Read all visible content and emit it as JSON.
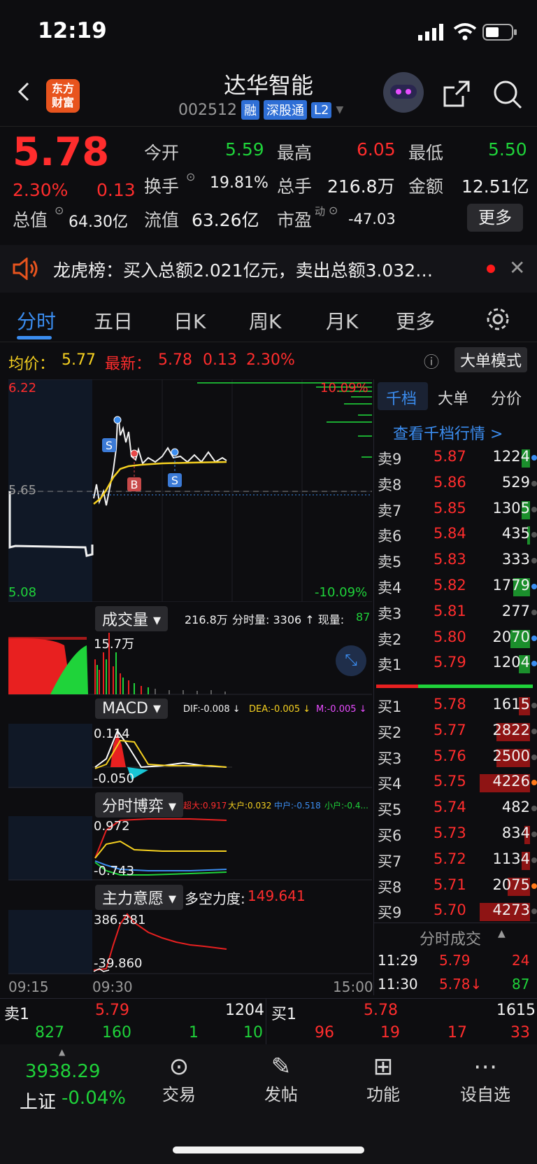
{
  "status": {
    "time": "12:19"
  },
  "header": {
    "logo_text": "东方\n财富",
    "stock_name": "达华智能",
    "code": "002512",
    "tags": [
      "融",
      "深股通",
      "L2"
    ]
  },
  "quote": {
    "price": "5.78",
    "pct": "2.30%",
    "change": "0.13",
    "open_label": "今开",
    "open": "5.59",
    "high_label": "最高",
    "high": "6.05",
    "low_label": "最低",
    "low": "5.50",
    "turnover_label": "换手",
    "turnover": "19.81%",
    "vol_label": "总手",
    "vol": "216.8万",
    "amount_label": "金额",
    "amount": "12.51亿",
    "mktcap_label": "总值",
    "mktcap": "64.30亿",
    "float_label": "流值",
    "float": "63.26亿",
    "pe_label": "市盈",
    "pe_sup": "动",
    "pe": "-47.03",
    "more": "更多"
  },
  "news": {
    "text": "龙虎榜：买入总额2.021亿元，卖出总额3.032…"
  },
  "tabs": [
    "分时",
    "五日",
    "日K",
    "周K",
    "月K",
    "更多"
  ],
  "info": {
    "avg_label": "均价：",
    "avg": "5.77",
    "latest_label": "最新：",
    "latest": "5.78",
    "chg": "0.13",
    "pct": "2.30%",
    "mode": "大单模式"
  },
  "main_chart": {
    "top": "6.22",
    "mid": "5.65",
    "bottom": "5.08",
    "top_pct": "10.09%",
    "bottom_pct": "-10.09%"
  },
  "volume": {
    "label": "成交量",
    "total": "216.8万",
    "stat": "分时量: 3306 ↑ 现量:",
    "now": "87",
    "peak": "15.7万"
  },
  "macd": {
    "label": "MACD",
    "dif": "DIF:-0.008 ↓",
    "dea": "DEA:-0.005 ↓",
    "m": "M:-0.005 ↓",
    "hi": "0.114",
    "lo": "-0.050"
  },
  "game": {
    "label": "分时博弈",
    "s1": "超大:0.917",
    "s2": "大户:0.032",
    "s3": "中户:-0.518",
    "s4": "小户:-0.4...",
    "hi": "0.972",
    "lo": "-0.743"
  },
  "will": {
    "label": "主力意愿",
    "force_label": "多空力度:",
    "force": "149.641",
    "hi": "386.381",
    "lo": "-39.860"
  },
  "times": {
    "t1": "09:15",
    "t2": "09:30",
    "t3": "15:00"
  },
  "ob_tabs": [
    "千档",
    "大单",
    "分价"
  ],
  "ob_link": "查看千档行情 >",
  "asks": [
    {
      "label": "卖9",
      "price": "5.87",
      "vol": "1224"
    },
    {
      "label": "卖8",
      "price": "5.86",
      "vol": "529"
    },
    {
      "label": "卖7",
      "price": "5.85",
      "vol": "1305"
    },
    {
      "label": "卖6",
      "price": "5.84",
      "vol": "435"
    },
    {
      "label": "卖5",
      "price": "5.83",
      "vol": "333"
    },
    {
      "label": "卖4",
      "price": "5.82",
      "vol": "1779"
    },
    {
      "label": "卖3",
      "price": "5.81",
      "vol": "277"
    },
    {
      "label": "卖2",
      "price": "5.80",
      "vol": "2070"
    },
    {
      "label": "卖1",
      "price": "5.79",
      "vol": "1204"
    }
  ],
  "bids": [
    {
      "label": "买1",
      "price": "5.78",
      "vol": "1615"
    },
    {
      "label": "买2",
      "price": "5.77",
      "vol": "2822"
    },
    {
      "label": "买3",
      "price": "5.76",
      "vol": "2500"
    },
    {
      "label": "买4",
      "price": "5.75",
      "vol": "4226"
    },
    {
      "label": "买5",
      "price": "5.74",
      "vol": "482"
    },
    {
      "label": "买6",
      "price": "5.73",
      "vol": "834"
    },
    {
      "label": "买7",
      "price": "5.72",
      "vol": "1134"
    },
    {
      "label": "买8",
      "price": "5.71",
      "vol": "2075"
    },
    {
      "label": "买9",
      "price": "5.70",
      "vol": "4273"
    }
  ],
  "ticks": {
    "title": "分时成交",
    "rows": [
      {
        "time": "11:29",
        "price": "5.79",
        "vol": "24"
      },
      {
        "time": "11:30",
        "price": "5.78↓",
        "vol": "87"
      }
    ]
  },
  "bottom_bar": {
    "ask_label": "卖1",
    "ask_price": "5.79",
    "ask_vol": "1204",
    "bid_label": "买1",
    "bid_price": "5.78",
    "bid_vol": "1615",
    "left_nums": [
      "827",
      "160",
      "1",
      "10"
    ],
    "right_nums": [
      "96",
      "19",
      "17",
      "33"
    ]
  },
  "nav": {
    "index_value": "3938.29",
    "index_name": "上证",
    "index_pct": "-0.04%",
    "items": [
      "交易",
      "发帖",
      "功能",
      "设自选"
    ]
  }
}
